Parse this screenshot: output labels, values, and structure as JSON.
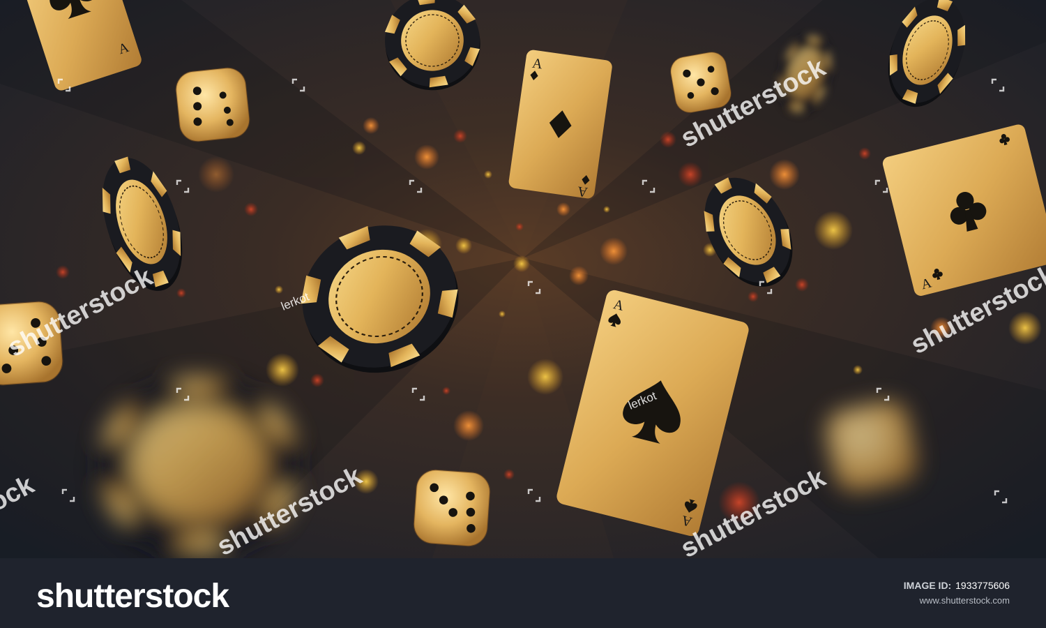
{
  "watermark": {
    "brand_text": "shutterstock",
    "contributor": "lerkot"
  },
  "footer": {
    "logo_text": "shutterstock",
    "image_id_label": "IMAGE ID:",
    "image_id_value": "1933775606",
    "url": "www.shutterstock.com"
  },
  "cards": [
    {
      "rank": "A",
      "suit": "spade-icon"
    },
    {
      "rank": "A",
      "suit": "diamond-icon"
    },
    {
      "rank": "A",
      "suit": "club-icon"
    },
    {
      "rank": "A",
      "suit": "spade-icon"
    }
  ],
  "colors": {
    "background_center": "#4a3324",
    "background_edge": "#1c2029",
    "gold": "#e2b45a",
    "chip_dark": "#17181c",
    "footer_bg": "#1f232d"
  }
}
